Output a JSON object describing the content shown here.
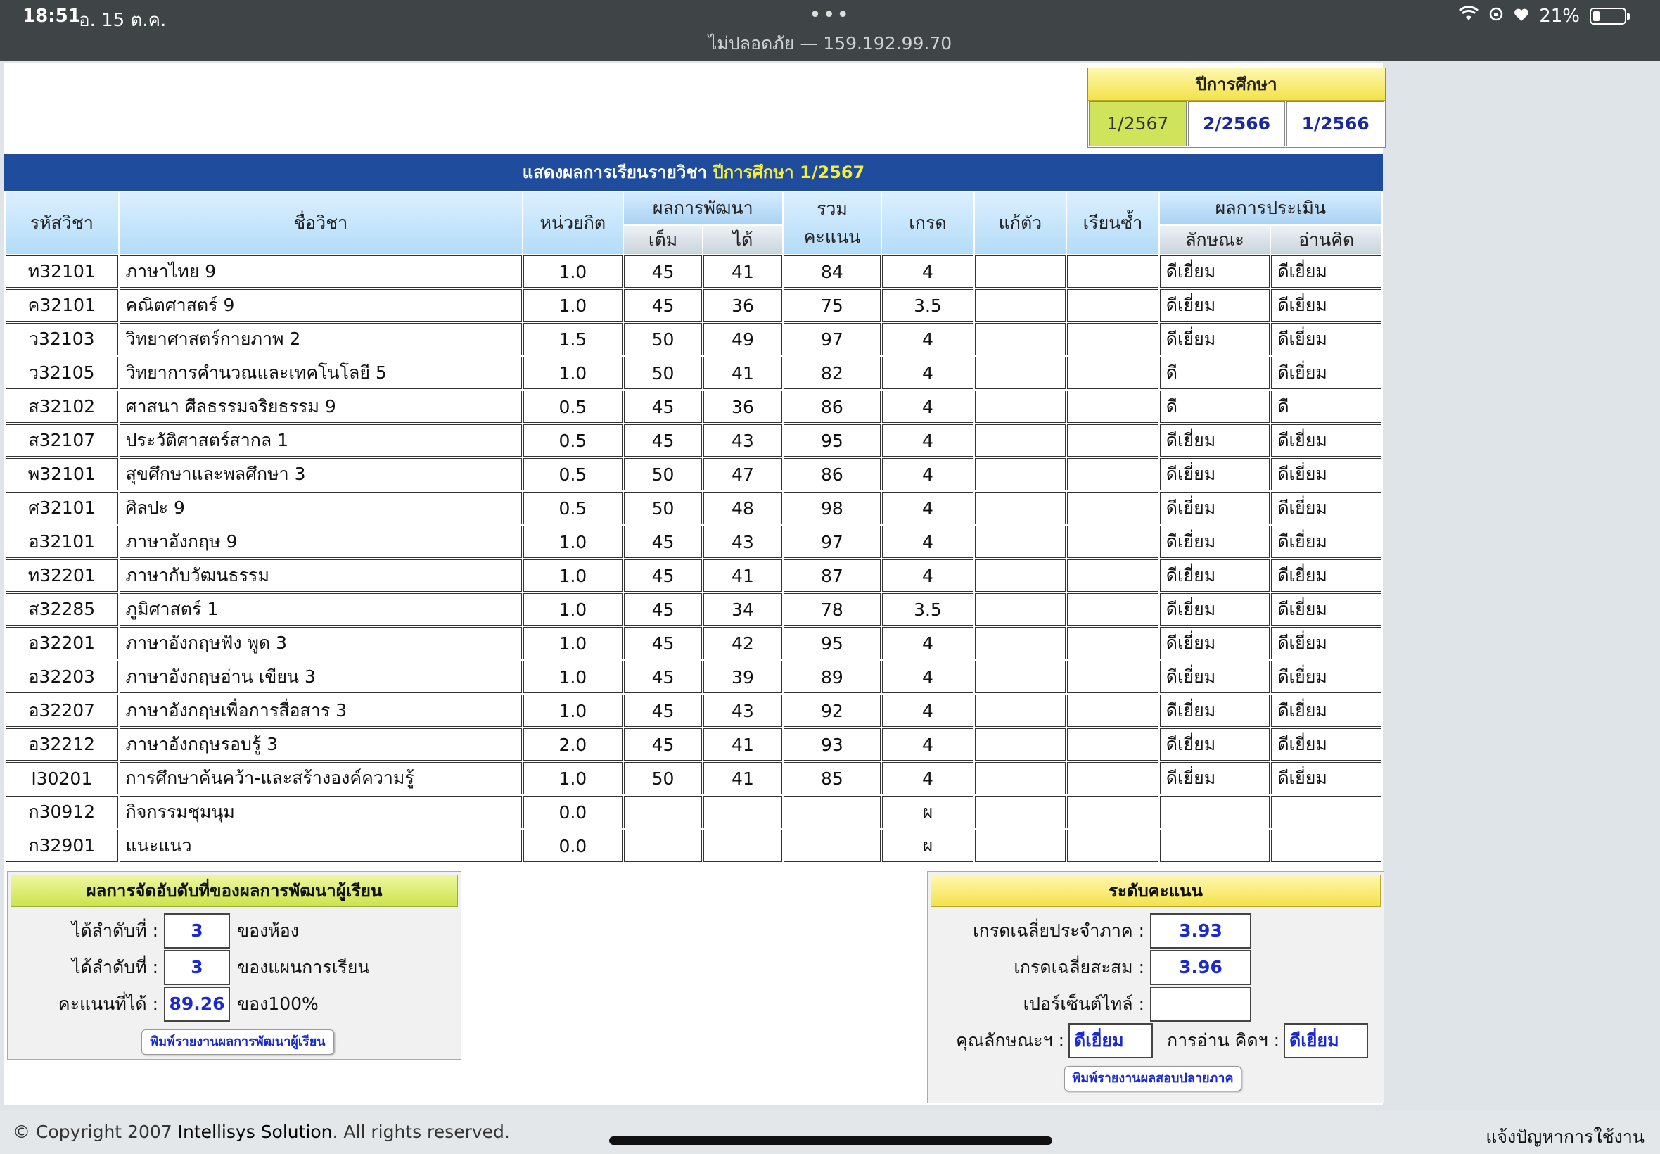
{
  "status_bar": {
    "time": "18:51",
    "date": "อ. 15 ต.ค.",
    "dots": "•••",
    "address": "ไม่ปลอดภัย — 159.192.99.70",
    "battery": "21%",
    "battery_level": 0.21
  },
  "year_selector": {
    "title": "ปีการศึกษา",
    "options": [
      "1/2567",
      "2/2566",
      "1/2566"
    ],
    "selected": "1/2567"
  },
  "table": {
    "title_prefix": "แสดงผลการเรียนรายวิชา",
    "title_year": "ปีการศึกษา 1/2567",
    "headers": {
      "code": "รหัสวิชา",
      "name": "ชื่อวิชา",
      "credit": "หน่วยกิต",
      "dev": "ผลการพัฒนา",
      "dev_full": "เต็ม",
      "dev_got": "ได้",
      "total_1": "รวม",
      "total_2": "คะแนน",
      "grade": "เกรด",
      "fix": "แก้ตัว",
      "repeat": "เรียนซ้ำ",
      "eval": "ผลการประเมิน",
      "eval_char": "ลักษณะ",
      "eval_read": "อ่านคิด"
    },
    "rows": [
      [
        "ท32101",
        "ภาษาไทย 9",
        "1.0",
        "45",
        "41",
        "84",
        "4",
        "",
        "",
        "ดีเยี่ยม",
        "ดีเยี่ยม"
      ],
      [
        "ค32101",
        "คณิตศาสตร์ 9",
        "1.0",
        "45",
        "36",
        "75",
        "3.5",
        "",
        "",
        "ดีเยี่ยม",
        "ดีเยี่ยม"
      ],
      [
        "ว32103",
        "วิทยาศาสตร์กายภาพ 2",
        "1.5",
        "50",
        "49",
        "97",
        "4",
        "",
        "",
        "ดีเยี่ยม",
        "ดีเยี่ยม"
      ],
      [
        "ว32105",
        "วิทยาการคำนวณและเทคโนโลยี 5",
        "1.0",
        "50",
        "41",
        "82",
        "4",
        "",
        "",
        "ดี",
        "ดีเยี่ยม"
      ],
      [
        "ส32102",
        "ศาสนา ศีลธรรมจริยธรรม 9",
        "0.5",
        "45",
        "36",
        "86",
        "4",
        "",
        "",
        "ดี",
        "ดี"
      ],
      [
        "ส32107",
        "ประวัติศาสตร์สากล 1",
        "0.5",
        "45",
        "43",
        "95",
        "4",
        "",
        "",
        "ดีเยี่ยม",
        "ดีเยี่ยม"
      ],
      [
        "พ32101",
        "สุขศึกษาและพลศึกษา 3",
        "0.5",
        "50",
        "47",
        "86",
        "4",
        "",
        "",
        "ดีเยี่ยม",
        "ดีเยี่ยม"
      ],
      [
        "ศ32101",
        "ศิลปะ 9",
        "0.5",
        "50",
        "48",
        "98",
        "4",
        "",
        "",
        "ดีเยี่ยม",
        "ดีเยี่ยม"
      ],
      [
        "อ32101",
        "ภาษาอังกฤษ 9",
        "1.0",
        "45",
        "43",
        "97",
        "4",
        "",
        "",
        "ดีเยี่ยม",
        "ดีเยี่ยม"
      ],
      [
        "ท32201",
        "ภาษากับวัฒนธรรม",
        "1.0",
        "45",
        "41",
        "87",
        "4",
        "",
        "",
        "ดีเยี่ยม",
        "ดีเยี่ยม"
      ],
      [
        "ส32285",
        "ภูมิศาสตร์ 1",
        "1.0",
        "45",
        "34",
        "78",
        "3.5",
        "",
        "",
        "ดีเยี่ยม",
        "ดีเยี่ยม"
      ],
      [
        "อ32201",
        "ภาษาอังกฤษฟัง พูด 3",
        "1.0",
        "45",
        "42",
        "95",
        "4",
        "",
        "",
        "ดีเยี่ยม",
        "ดีเยี่ยม"
      ],
      [
        "อ32203",
        "ภาษาอังกฤษอ่าน เขียน 3",
        "1.0",
        "45",
        "39",
        "89",
        "4",
        "",
        "",
        "ดีเยี่ยม",
        "ดีเยี่ยม"
      ],
      [
        "อ32207",
        "ภาษาอังกฤษเพื่อการสื่อสาร 3",
        "1.0",
        "45",
        "43",
        "92",
        "4",
        "",
        "",
        "ดีเยี่ยม",
        "ดีเยี่ยม"
      ],
      [
        "อ32212",
        "ภาษาอังกฤษรอบรู้ 3",
        "2.0",
        "45",
        "41",
        "93",
        "4",
        "",
        "",
        "ดีเยี่ยม",
        "ดีเยี่ยม"
      ],
      [
        "I30201",
        "การศึกษาค้นคว้า-และสร้างองค์ความรู้",
        "1.0",
        "50",
        "41",
        "85",
        "4",
        "",
        "",
        "ดีเยี่ยม",
        "ดีเยี่ยม"
      ],
      [
        "ก30912",
        "กิจกรรมชุมนุม",
        "0.0",
        "",
        "",
        "",
        "ผ",
        "",
        "",
        "",
        ""
      ],
      [
        "ก32901",
        "แนะแนว",
        "0.0",
        "",
        "",
        "",
        "ผ",
        "",
        "",
        "",
        ""
      ]
    ]
  },
  "rank_panel": {
    "title": "ผลการจัดอับดับที่ของผลการพัฒนาผู้เรียน",
    "rows": [
      {
        "label": "ได้ลำดับที่ :",
        "value": "3",
        "suffix": "ของห้อง"
      },
      {
        "label": "ได้ลำดับที่ :",
        "value": "3",
        "suffix": "ของแผนการเรียน"
      },
      {
        "label": "คะแนนที่ได้ :",
        "value": "89.26",
        "suffix": "ของ100%"
      }
    ],
    "print_button": "พิมพ์รายงานผลการพัฒนาผู้เรียน"
  },
  "score_panel": {
    "title": "ระดับคะแนน",
    "gpa_term_label": "เกรดเฉลี่ยประจำภาค :",
    "gpa_term": "3.93",
    "gpa_cum_label": "เกรดเฉลี่ยสะสม :",
    "gpa_cum": "3.96",
    "percentile_label": "เปอร์เซ็นต์ไทล์ :",
    "percentile": "",
    "char_label": "คุณลักษณะฯ :",
    "char_value": "ดีเยี่ยม",
    "read_label": "การอ่าน คิดฯ :",
    "read_value": "ดีเยี่ยม",
    "print_button": "พิมพ์รายงานผลสอบปลายภาค"
  },
  "footer": {
    "copyright": "© Copyright 2007",
    "company": "Intellisys Solution",
    "rights": ". All rights reserved.",
    "report_problem": "แจ้งปัญหาการใช้งาน"
  }
}
